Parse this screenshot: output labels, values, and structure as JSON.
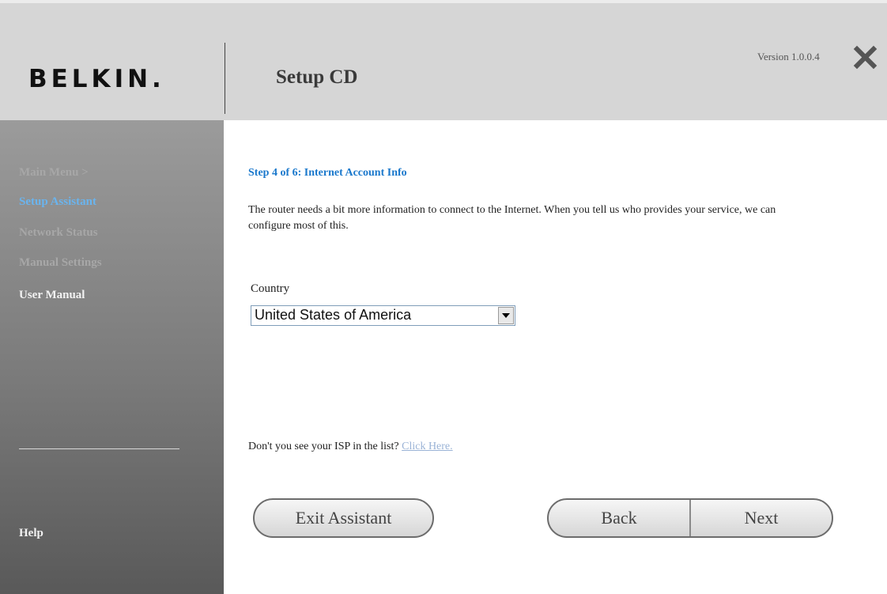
{
  "header": {
    "logo": "BELKIN.",
    "title": "Setup CD",
    "version": "Version 1.0.0.4"
  },
  "sidebar": {
    "items": [
      {
        "label": "Main Menu  >"
      },
      {
        "label": "Setup Assistant"
      },
      {
        "label": "Network Status"
      },
      {
        "label": "Manual Settings"
      },
      {
        "label": "User Manual"
      }
    ],
    "help": "Help"
  },
  "main": {
    "step_title": "Step 4 of 6: Internet Account Info",
    "description": "The router needs a bit more information to connect to the Internet. When you tell us who provides your service, we can configure most of this.",
    "country_label": "Country",
    "country_value": "United States of America",
    "isp_question": "Don't you see your ISP in the list?",
    "isp_link": "Click Here."
  },
  "buttons": {
    "exit": "Exit Assistant",
    "back": "Back",
    "next": "Next"
  },
  "colors": {
    "accent": "#1a78cc",
    "active_nav": "#6ab4ee",
    "header_bg": "#d6d6d6"
  }
}
